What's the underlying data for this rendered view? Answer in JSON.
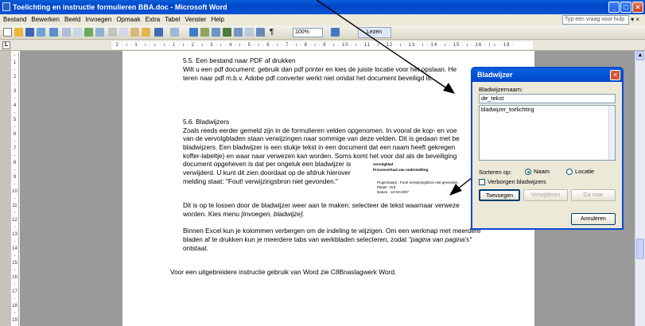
{
  "window": {
    "title": "Toelichting en instructie formulieren BBA.doc - Microsoft Word"
  },
  "menu": [
    "Bestand",
    "Bewerken",
    "Beeld",
    "Invoegen",
    "Opmaak",
    "Extra",
    "Tabel",
    "Venster",
    "Help"
  ],
  "ask": {
    "placeholder": "Typ een vraag voor hulp"
  },
  "toolbar": {
    "zoom": "100%",
    "lezen": "Lezen"
  },
  "ruler": "· 2 · ı · 1 · ı · ⌂ · ı · 1 · ı · 2 · ı · 3 · ı · 4 · ı · 5 · ı · 6 · ı · 7 · ı · 8 · ı · 9 · ı · 10 · ı · 11 · ı · 12 · ı · 13 · ı · 14 · ı · 15 · ı · 16 · ı ⌂ · 18 ·",
  "vruler": [
    "-",
    "1",
    "-",
    "2",
    "-",
    "3",
    "-",
    "4",
    "-",
    "5",
    "-",
    "6",
    "-",
    "7",
    "-",
    "8",
    "-",
    "9",
    "-",
    "10",
    "-",
    "11",
    "-",
    "12",
    "-",
    "13",
    "-",
    "14",
    "-",
    "15",
    "-",
    "16",
    "-",
    "17",
    "-",
    "18",
    "-",
    "19"
  ],
  "document": {
    "s55_heading": "5.5.      Een bestand naar PDF af drukken",
    "s55_l1": "Wilt u een pdf document: gebruik dan pdf printer en kies de juiste locatie voor het opslaan. He",
    "s55_l2": "teren naar pdf m.b.v. Adobe pdf converter werkt niet omdat het document beveiligd is.",
    "s56_heading": "5.6.      Bladwijzers",
    "s56_l1": "Zoals reeds eerder gemeld zijn in de formulieren velden opgenomen. In vooral de kop- en voe",
    "s56_l2": "van de vervolgbladen staan verwijzingen naar sommige van deze velden. Dit is gedaan met be",
    "s56_l3": "bladwijzers. Een bladwijzer is een stukje tekst in een document dat een naam heeft gekregen",
    "s56_l4": "koffer-labeltje) en waar naar verwezen kan worden. Soms komt het voor dat als de beveiliging",
    "s56_l5": "document opgeheven is dat per ongeluk een bladwijzer is",
    "s56_l6": "verwijderd. U kunt dit zien doordaat op de afdruk hierover",
    "s56_l7": "melding staat: \"Fout! verwijzingsbron niet gevonden.\"",
    "mini": {
      "t1": "vervolgblad",
      "t2": "Procesverhaal van onderstelling",
      "r1": "Projectnaam    :  Fout! Verwijzingsbron niet gevonden.",
      "r2": "Plaats             :  Erd",
      "r3": "Datum            :  10-03-2007"
    },
    "p2_l1": "Dit is op te lossen door de bladwijzer weer aan te maken: selecteer de tekst waarnaar verweze",
    "p2_l2a": "worden. Kies menu ",
    "p2_l2b": "[invoegen, bladwijze].",
    "p3_l1": "Binnen Excel kun je kolommen verbergen om de indeling te wijzigen. Om een werkmap met meerdere",
    "p3_l2": "bladen af te drukken kun je meerdere tabs van werkbladen selecteren, zodat ",
    "p3_l2b": "\"pagina van pagina's\"",
    "p3_l3": "ontstaat.",
    "p4": "Voor een uitgebreidere instructie gebruik van Word zie C8Bnaslagwerk Word."
  },
  "dialog": {
    "title": "Bladwijzer",
    "name_label": "Bladwijzernaam:",
    "name_value": "de_tekst",
    "list": [
      "bladwijzer_toelichting"
    ],
    "sort_label": "Sorteren op:",
    "sort_name": "Naam",
    "sort_location": "Locatie",
    "hidden_label": "Verborgen bladwijzers",
    "add": "Toevoegen",
    "delete": "Verwijderen",
    "goto": "Ga naar",
    "cancel": "Annuleren"
  }
}
